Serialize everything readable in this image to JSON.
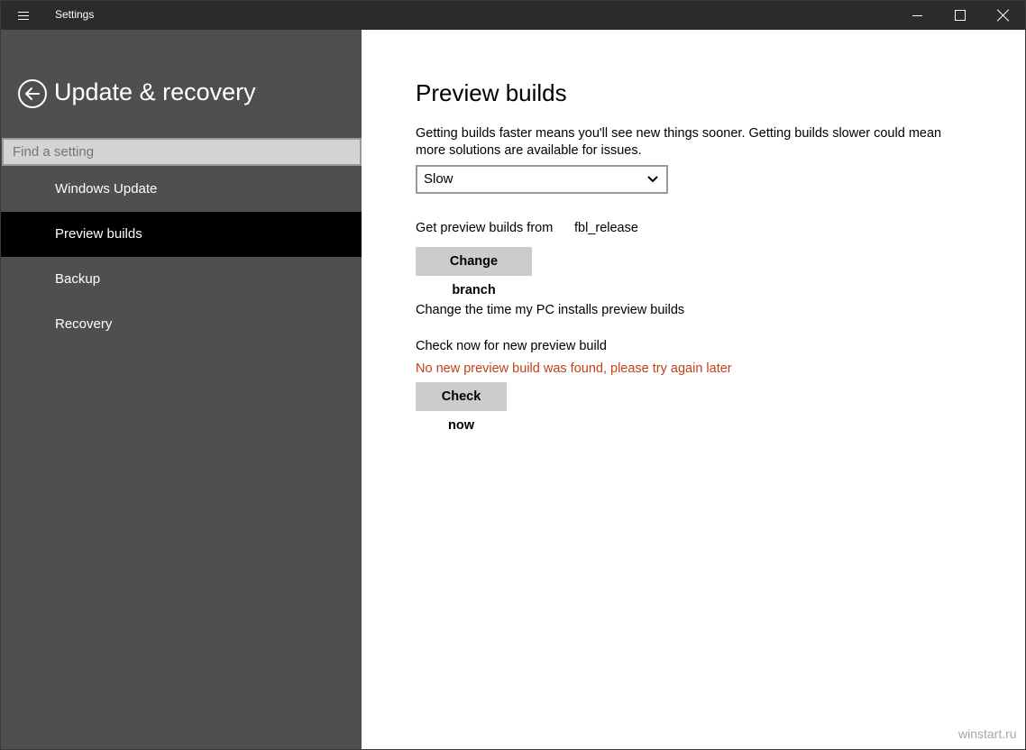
{
  "window": {
    "title": "Settings"
  },
  "sidebar": {
    "title": "Update & recovery",
    "search_placeholder": "Find a setting",
    "items": [
      {
        "label": "Windows Update",
        "selected": false
      },
      {
        "label": "Preview builds",
        "selected": true
      },
      {
        "label": "Backup",
        "selected": false
      },
      {
        "label": "Recovery",
        "selected": false
      }
    ]
  },
  "main": {
    "title": "Preview builds",
    "description": "Getting builds faster means you'll see new things sooner. Getting builds slower could mean more solutions are available for issues.",
    "speed_select": {
      "value": "Slow"
    },
    "branch_label": "Get preview builds from",
    "branch_value": "fbl_release",
    "change_branch_label": "Change branch",
    "time_link": "Change the time my PC installs preview builds",
    "check_label": "Check now for new preview build",
    "status_message": "No new preview build was found, please try again later",
    "check_now_label": "Check now"
  },
  "watermark": "winstart.ru",
  "colors": {
    "titlebar": "#2b2b2b",
    "sidebar": "#4f4f4f",
    "selected_item": "#000000",
    "button": "#cccccc",
    "status_error": "#c4411a"
  }
}
